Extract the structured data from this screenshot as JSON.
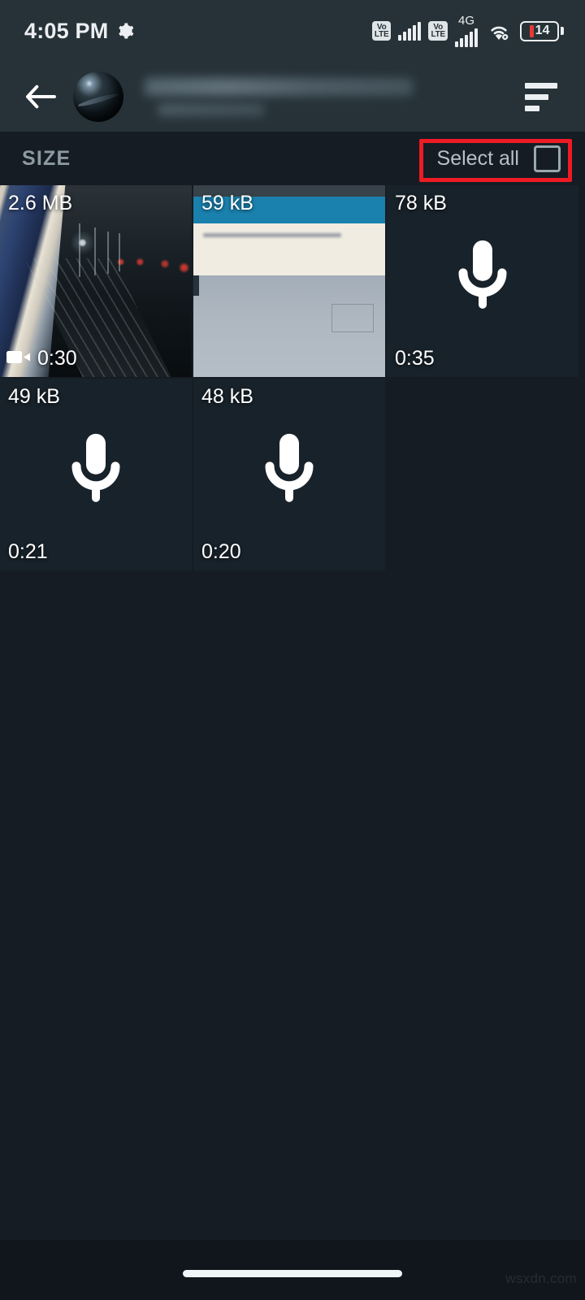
{
  "status_bar": {
    "time": "4:05 PM",
    "gear_icon": "gear-icon",
    "volte_label_1": "Vo",
    "volte_label_2": "LTE",
    "volte_label_3": "Vo",
    "volte_label_4": "LTE",
    "network_type": "4G",
    "wifi_icon": "wifi-icon",
    "battery_percent": "14"
  },
  "app_bar": {
    "back_icon": "back-arrow-icon",
    "avatar": "contact-avatar",
    "title": "",
    "subtitle": "",
    "sort_icon": "sort-icon"
  },
  "toolbar": {
    "size_label": "SIZE",
    "select_all_label": "Select all",
    "checkbox_state": "unchecked",
    "highlight_color": "#ee1b24"
  },
  "media_grid": {
    "items": [
      {
        "size": "2.6 MB",
        "duration": "0:30",
        "type": "video",
        "icon": "video-camera-icon"
      },
      {
        "size": "59 kB",
        "duration": "",
        "type": "image",
        "icon": ""
      },
      {
        "size": "78 kB",
        "duration": "0:35",
        "type": "audio",
        "icon": "microphone-icon"
      },
      {
        "size": "49 kB",
        "duration": "0:21",
        "type": "audio",
        "icon": "microphone-icon"
      },
      {
        "size": "48 kB",
        "duration": "0:20",
        "type": "audio",
        "icon": "microphone-icon"
      }
    ]
  },
  "nav_bar": {
    "home_indicator": "home-gesture-pill"
  },
  "watermark": {
    "text": "wsxdn.com"
  },
  "colors": {
    "page_background": "#161c23",
    "bar_background": "#263238",
    "tile_background": "#18222a",
    "accent_red": "#ee1b24",
    "text_primary": "#ffffff",
    "text_muted": "#8d9aa3"
  }
}
